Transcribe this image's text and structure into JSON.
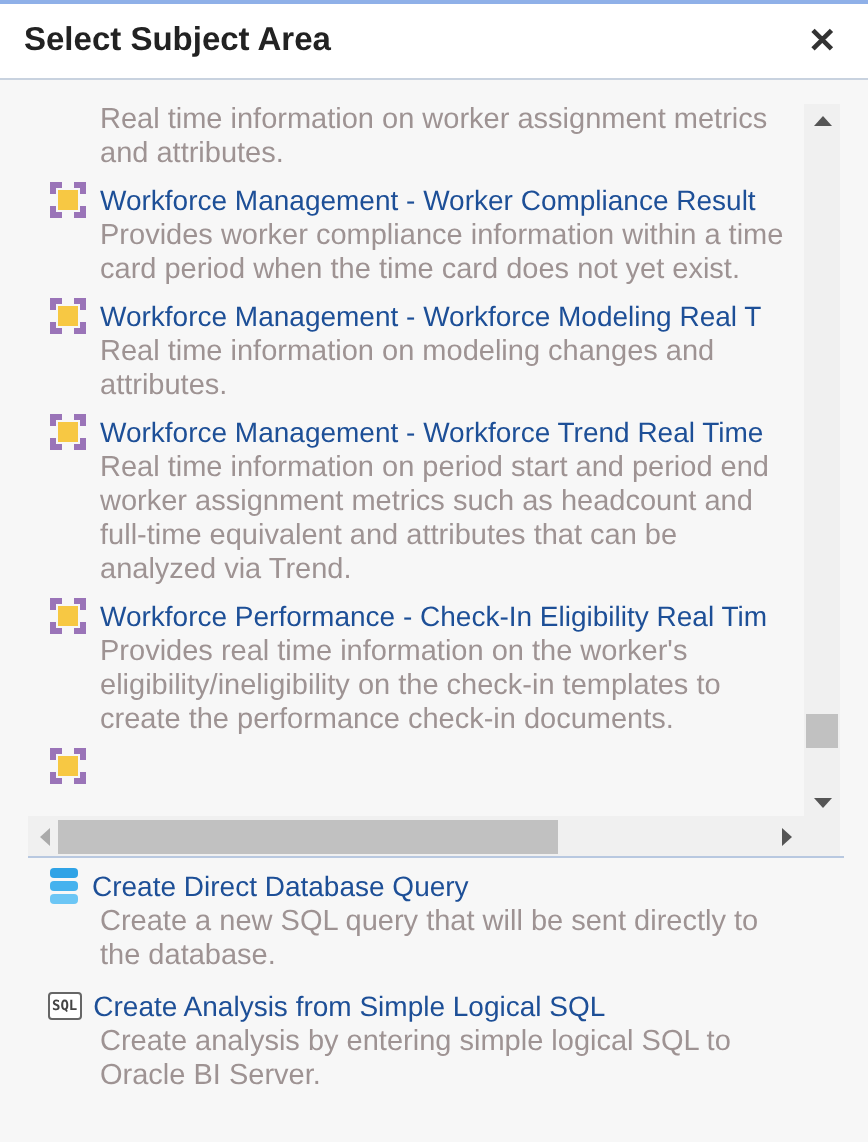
{
  "dialog": {
    "title": "Select Subject Area",
    "close": "✕"
  },
  "subject_areas": [
    {
      "kind": "subject",
      "description": "Real time information on worker assignment metrics and attributes."
    },
    {
      "kind": "subject",
      "title": "Workforce Management - Worker Compliance Result",
      "description": "Provides worker compliance information within a time card period when the time card does not yet exist."
    },
    {
      "kind": "subject",
      "title": "Workforce Management - Workforce Modeling Real T",
      "description": "Real time information on modeling changes and attributes."
    },
    {
      "kind": "subject",
      "title": "Workforce Management - Workforce Trend Real Time",
      "description": "Real time information on period start and period end worker assignment metrics such as headcount and full-time equivalent and attributes that can be analyzed via Trend."
    },
    {
      "kind": "subject",
      "title": "Workforce Performance - Check-In Eligibility Real Tim",
      "description": "Provides real time information on the worker's eligibility/ineligibility on the check-in templates to create the performance check-in documents."
    },
    {
      "kind": "icon_only"
    }
  ],
  "actions": [
    {
      "kind": "database",
      "title": "Create Direct Database Query",
      "description": "Create a new SQL query that will be sent directly to the database."
    },
    {
      "kind": "sql",
      "badge": "SQL",
      "title": "Create Analysis from Simple Logical SQL",
      "description": "Create analysis by entering simple logical SQL to Oracle BI Server."
    }
  ]
}
